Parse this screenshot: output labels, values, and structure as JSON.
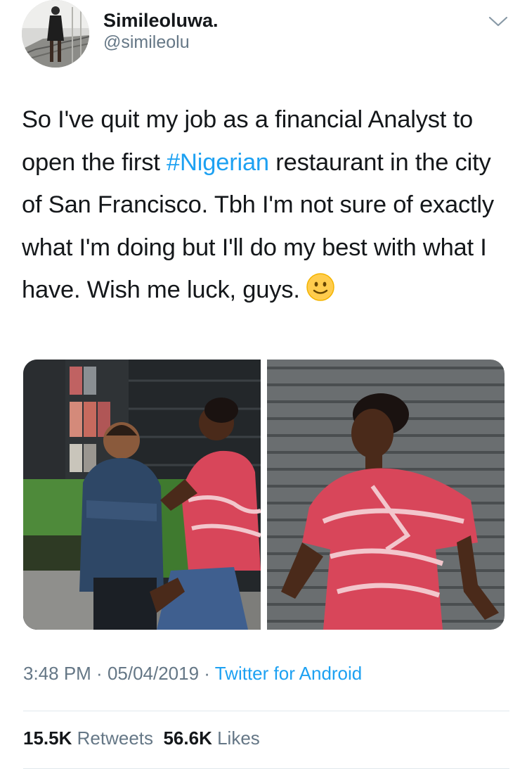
{
  "tweet": {
    "author": {
      "display_name": "Simileoluwa.",
      "handle": "@simileolu"
    },
    "text_before_hashtag": "So I've quit my job as a financial Analyst to open the first ",
    "hashtag": "#Nigerian",
    "text_after_hashtag": " restaurant in the city of San Francisco. Tbh I'm not sure of exactly what I'm doing but I'll do my best with what I have. Wish me luck, guys.",
    "emoji": "slightly-smiling-face",
    "media": [
      {
        "kind": "photo",
        "subject": "chef and woman in red print top leaning on storefront"
      },
      {
        "kind": "photo",
        "subject": "woman in red print top posing in front of metal shutter"
      }
    ],
    "meta": {
      "time": "3:48 PM",
      "sep1": " · ",
      "date": "05/04/2019",
      "sep2": " · ",
      "source": "Twitter for Android"
    },
    "stats": {
      "retweets_count": "15.5K",
      "retweets_label": "Retweets",
      "likes_count": "56.6K",
      "likes_label": "Likes"
    }
  },
  "colors": {
    "link": "#1da1f2",
    "secondary_text": "#657786",
    "primary_text": "#14171a",
    "divider": "#e1e8ed"
  },
  "icons": {
    "caret": "chevron-down-icon",
    "emoji": "slightly-smiling-face-icon"
  }
}
